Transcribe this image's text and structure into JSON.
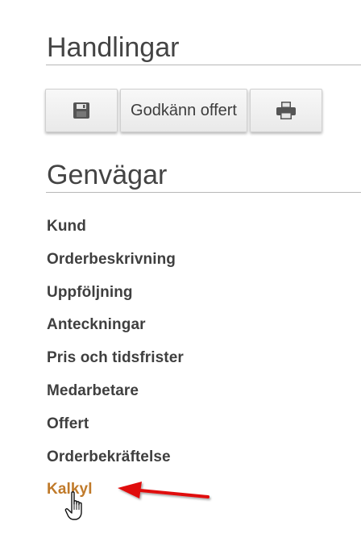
{
  "actions": {
    "title": "Handlingar",
    "buttons": [
      {
        "icon": "save-icon"
      },
      {
        "label": "Godkänn offert"
      },
      {
        "icon": "print-icon"
      }
    ]
  },
  "shortcuts": {
    "title": "Genvägar",
    "items": [
      "Kund",
      "Orderbeskrivning",
      "Uppföljning",
      "Anteckningar",
      "Pris och tidsfrister",
      "Medarbetare",
      "Offert",
      "Orderbekräftelse",
      "Kalkyl"
    ],
    "active_item": "Kalkyl"
  },
  "colors": {
    "active_link": "#c07a2a",
    "annotation_arrow": "#e01010"
  }
}
